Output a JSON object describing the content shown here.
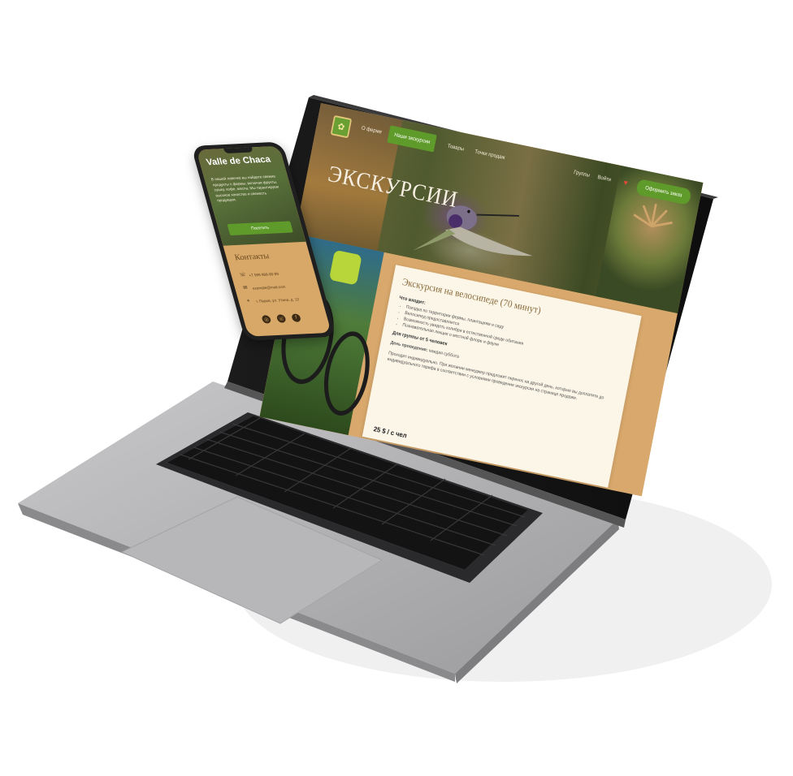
{
  "website": {
    "nav": {
      "about": "О ферме",
      "excursions": "Наши экскурсии",
      "item3": "Товары",
      "item4": "Точки продаж",
      "groups": "Группы",
      "login": "Войти",
      "order": "Оформить заказ"
    },
    "hero_title": "ЭКСКУРСИИ",
    "card": {
      "title": "Экскурсия на велосипеде (70 минут)",
      "included_label": "Что входит:",
      "included": [
        "Поездка по территории фермы, плантациям и саду",
        "Велосипед предоставляется",
        "Возможность увидеть колибри в естественной среде обитания",
        "Познавательная лекция о местной флоре и фауне"
      ],
      "groups_label": "Для группы от 5 человек",
      "days_label": "День проведения:",
      "days_value": "каждая суббота",
      "note": "Проходит индивидуально. При желании менеджер предложит перенос на другой день, которые вы доплатите до индивидуального тарифа в соответствии с условиями проведения экскурсии на странице продажи.",
      "price": "25 $ / с чел"
    }
  },
  "phone": {
    "title": "Valle de Chaca",
    "description": "В нашей лавочке вы найдете свежие продукты с фермы, включая фрукты, сушку, кофе, масла. Мы гарантируем высокое качество и свежесть продукции.",
    "button": "Посетить",
    "contacts_title": "Контакты",
    "phone": "+7 999 999-99-99",
    "email": "exemple@mail.com",
    "address": "г. Перов, ул. Утина, д. 12"
  },
  "colors": {
    "accent": "#5f9b2a",
    "tan": "#d8a86c",
    "card": "#fbf6e8"
  }
}
